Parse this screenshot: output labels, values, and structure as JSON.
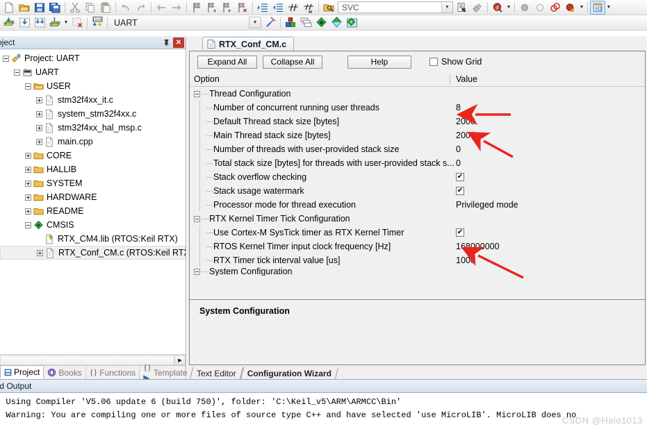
{
  "toolbar_top": {
    "groups": [
      {
        "buttons": [
          {
            "name": "new-file-icon",
            "label": "New"
          },
          {
            "name": "open-file-icon",
            "label": "Open"
          },
          {
            "name": "save-icon",
            "label": "Save"
          },
          {
            "name": "save-all-icon",
            "label": "Save All"
          }
        ]
      },
      {
        "buttons": [
          {
            "name": "cut-icon",
            "label": "Cut"
          },
          {
            "name": "copy-icon",
            "label": "Copy"
          },
          {
            "name": "paste-icon",
            "label": "Paste"
          }
        ]
      },
      {
        "buttons": [
          {
            "name": "undo-icon",
            "label": "Undo"
          },
          {
            "name": "redo-icon",
            "label": "Redo"
          }
        ]
      },
      {
        "buttons": [
          {
            "name": "navigate-back-icon",
            "label": "Back"
          },
          {
            "name": "navigate-forward-icon",
            "label": "Forward"
          }
        ]
      },
      {
        "buttons": [
          {
            "name": "bookmark-toggle-icon",
            "label": "Insert/Remove Bookmark"
          },
          {
            "name": "bookmark-prev-icon",
            "label": "Previous Bookmark"
          },
          {
            "name": "bookmark-next-icon",
            "label": "Next Bookmark"
          },
          {
            "name": "bookmark-clear-icon",
            "label": "Clear All Bookmarks"
          }
        ]
      },
      {
        "buttons": [
          {
            "name": "indent-right-icon",
            "label": "Indent"
          },
          {
            "name": "indent-left-icon",
            "label": "Outdent"
          },
          {
            "name": "comment-icon",
            "label": "Comment"
          },
          {
            "name": "uncomment-icon",
            "label": "Uncomment"
          }
        ]
      }
    ],
    "search": {
      "icon": "find-in-files-icon",
      "value": "SVC",
      "placeholder": ""
    },
    "after_search": [
      {
        "name": "find-in-files-icon",
        "label": "Find in Files"
      },
      {
        "name": "incremental-find-icon",
        "label": "Incremental Find"
      }
    ],
    "debug": [
      {
        "name": "start-debug-icon",
        "label": "Start/Stop Debug Session"
      }
    ],
    "breakpoints": [
      {
        "name": "insert-breakpoint-icon",
        "label": "Insert/Remove Breakpoint"
      },
      {
        "name": "enable-breakpoint-icon",
        "label": "Enable/Disable Breakpoint"
      },
      {
        "name": "disable-all-breakpoints-icon",
        "label": "Disable All Breakpoints"
      },
      {
        "name": "kill-all-breakpoints-icon",
        "label": "Kill All Breakpoints"
      }
    ],
    "window_button": {
      "name": "manage-window-icon",
      "label": "Window"
    }
  },
  "toolbar_build": {
    "buttons": [
      {
        "name": "translate-icon",
        "label": "Translate"
      },
      {
        "name": "build-icon",
        "label": "Build"
      },
      {
        "name": "rebuild-icon",
        "label": "Rebuild"
      },
      {
        "name": "batch-build-icon",
        "label": "Batch Build"
      },
      {
        "name": "stop-build-icon",
        "label": "Stop Build"
      },
      {
        "name": "download-icon",
        "label": "Download"
      }
    ],
    "target": {
      "value": "UART",
      "dropdown_icon": "chevron-down-icon"
    },
    "right_buttons": [
      {
        "name": "target-options-icon",
        "label": "Options for Target"
      },
      {
        "name": "manage-project-items-icon",
        "label": "Manage Project Items"
      },
      {
        "name": "multi-project-icon",
        "label": "Multi-Project"
      },
      {
        "name": "pack-installer-icon",
        "label": "Pack Installer"
      },
      {
        "name": "manage-run-time-env-icon",
        "label": "Manage Run-Time Environment"
      },
      {
        "name": "select-software-packs-icon",
        "label": "Select Software Packs"
      }
    ]
  },
  "project_panel": {
    "title": "oject",
    "pin_icon": "pin-icon",
    "close_icon": "close-icon",
    "tree": [
      {
        "level": 0,
        "label": "Project: UART",
        "icon": "project-icon",
        "toggle": "minus"
      },
      {
        "level": 1,
        "label": "UART",
        "icon": "target-icon",
        "toggle": "minus"
      },
      {
        "level": 2,
        "label": "USER",
        "icon": "folder-open-icon",
        "toggle": "minus"
      },
      {
        "level": 3,
        "label": "stm32f4xx_it.c",
        "icon": "c-file-icon",
        "toggle": "plus"
      },
      {
        "level": 3,
        "label": "system_stm32f4xx.c",
        "icon": "c-file-icon",
        "toggle": "plus"
      },
      {
        "level": 3,
        "label": "stm32f4xx_hal_msp.c",
        "icon": "c-file-icon",
        "toggle": "plus"
      },
      {
        "level": 3,
        "label": "main.cpp",
        "icon": "c-file-icon",
        "toggle": "plus"
      },
      {
        "level": 2,
        "label": "CORE",
        "icon": "folder-icon",
        "toggle": "plus"
      },
      {
        "level": 2,
        "label": "HALLIB",
        "icon": "folder-icon",
        "toggle": "plus"
      },
      {
        "level": 2,
        "label": "SYSTEM",
        "icon": "folder-icon",
        "toggle": "plus"
      },
      {
        "level": 2,
        "label": "HARDWARE",
        "icon": "folder-icon",
        "toggle": "plus"
      },
      {
        "level": 2,
        "label": "README",
        "icon": "folder-icon",
        "toggle": "plus"
      },
      {
        "level": 2,
        "label": "CMSIS",
        "icon": "cmsis-icon",
        "toggle": "minus"
      },
      {
        "level": 3,
        "label": "RTX_CM4.lib (RTOS:Keil RTX)",
        "icon": "lib-file-icon",
        "toggle": "none"
      },
      {
        "level": 3,
        "label": "RTX_Conf_CM.c (RTOS:Keil RTX)",
        "icon": "c-file-icon",
        "toggle": "plus",
        "selected": true
      }
    ],
    "tabs": [
      {
        "label": "Project",
        "icon": "project-tab-icon",
        "active": true
      },
      {
        "label": "Books",
        "icon": "books-icon",
        "active": false
      },
      {
        "label": "Functions",
        "icon": "functions-icon",
        "active": false
      },
      {
        "label": "Templates",
        "icon": "templates-icon",
        "active": false
      }
    ]
  },
  "editor": {
    "document_tab": {
      "label": "RTX_Conf_CM.c",
      "icon": "c-file-icon"
    },
    "wizard_toolbar": {
      "expand_all": "Expand All",
      "collapse_all": "Collapse All",
      "help": "Help",
      "show_grid_label": "Show Grid",
      "show_grid_checked": false
    },
    "grid_headers": {
      "option": "Option",
      "value": "Value"
    },
    "rows": [
      {
        "level": 0,
        "option": "Thread Configuration",
        "value": "",
        "type": "group",
        "toggle": "minus"
      },
      {
        "level": 1,
        "option": "Number of concurrent running user threads",
        "value": "8",
        "type": "text"
      },
      {
        "level": 1,
        "option": "Default Thread stack size [bytes]",
        "value": "2000",
        "type": "text"
      },
      {
        "level": 1,
        "option": "Main Thread stack size [bytes]",
        "value": "2000",
        "type": "text"
      },
      {
        "level": 1,
        "option": "Number of threads with user-provided stack size",
        "value": "0",
        "type": "text"
      },
      {
        "level": 1,
        "option": "Total stack size [bytes] for threads with user-provided stack s...",
        "value": "0",
        "type": "text"
      },
      {
        "level": 1,
        "option": "Stack overflow checking",
        "value": "",
        "type": "checkbox",
        "checked": true
      },
      {
        "level": 1,
        "option": "Stack usage watermark",
        "value": "",
        "type": "checkbox",
        "checked": true
      },
      {
        "level": 1,
        "option": "Processor mode for thread execution",
        "value": "Privileged mode",
        "type": "text"
      },
      {
        "level": 0,
        "option": "RTX Kernel Timer Tick Configuration",
        "value": "",
        "type": "group",
        "toggle": "minus"
      },
      {
        "level": 1,
        "option": "Use Cortex-M SysTick timer as RTX Kernel Timer",
        "value": "",
        "type": "checkbox",
        "checked": true
      },
      {
        "level": 1,
        "option": "RTOS Kernel Timer input clock frequency [Hz]",
        "value": "168000000",
        "type": "text"
      },
      {
        "level": 1,
        "option": "RTX Timer tick interval value [us]",
        "value": "1000",
        "type": "text"
      },
      {
        "level": 0,
        "option": "System Configuration",
        "value": "",
        "type": "group",
        "toggle": "minus",
        "clipped": true
      }
    ],
    "description": "System Configuration",
    "bottom_tabs": [
      {
        "label": "Text Editor",
        "active": false
      },
      {
        "label": "Configuration Wizard",
        "active": true
      }
    ]
  },
  "build_output": {
    "title": "ild Output",
    "lines": [
      "* Using Compiler 'V5.06 update 6 (build 750)', folder: 'C:\\Keil_v5\\ARM\\ARMCC\\Bin'",
      "* Warning: You are compiling one or more files of source type C++ and have selected 'use MicroLIB'. MicroLIB does no"
    ]
  },
  "watermark": "CSDN @Halo1013",
  "annotations": {
    "arrow_color": "#e8251f",
    "arrows": [
      {
        "target": "Number of concurrent running user threads value"
      },
      {
        "target": "Main Thread stack size value"
      },
      {
        "target": "RTOS Kernel Timer input clock frequency value"
      }
    ]
  },
  "colors": {
    "accent": "#cedce9",
    "selection": "#f0f0f0",
    "arrow": "#e8251f",
    "panel_bg": "#f0f0f0"
  }
}
